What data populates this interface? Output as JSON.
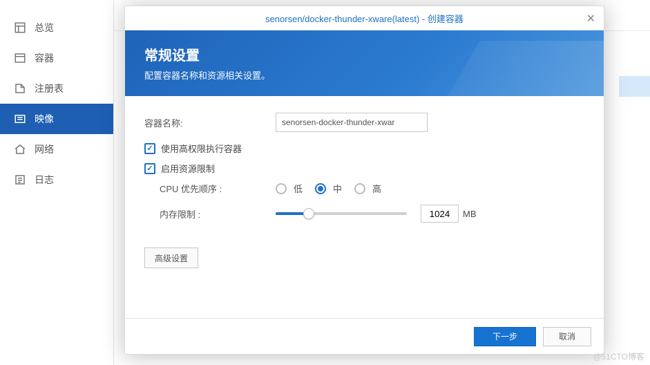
{
  "sidebar": {
    "items": [
      {
        "label": "总览"
      },
      {
        "label": "容器"
      },
      {
        "label": "注册表"
      },
      {
        "label": "映像"
      },
      {
        "label": "网络"
      },
      {
        "label": "日志"
      }
    ]
  },
  "modal": {
    "title": "senorsen/docker-thunder-xware(latest) - 创建容器",
    "banner_title": "常规设置",
    "banner_sub": "配置容器名称和资源相关设置。",
    "container_name_label": "容器名称:",
    "container_name_value": "senorsen-docker-thunder-xwar",
    "chk_high_priv": "使用高权限执行容器",
    "chk_resource_limit": "启用资源限制",
    "cpu_label": "CPU 优先顺序 :",
    "cpu_options": {
      "low": "低",
      "mid": "中",
      "high": "高"
    },
    "cpu_selected": "mid",
    "mem_label": "内存限制 :",
    "mem_value": "1024",
    "mem_unit": "MB",
    "adv_btn": "高级设置",
    "next_btn": "下一步",
    "cancel_btn": "取消"
  },
  "watermark": "@51CTO博客"
}
